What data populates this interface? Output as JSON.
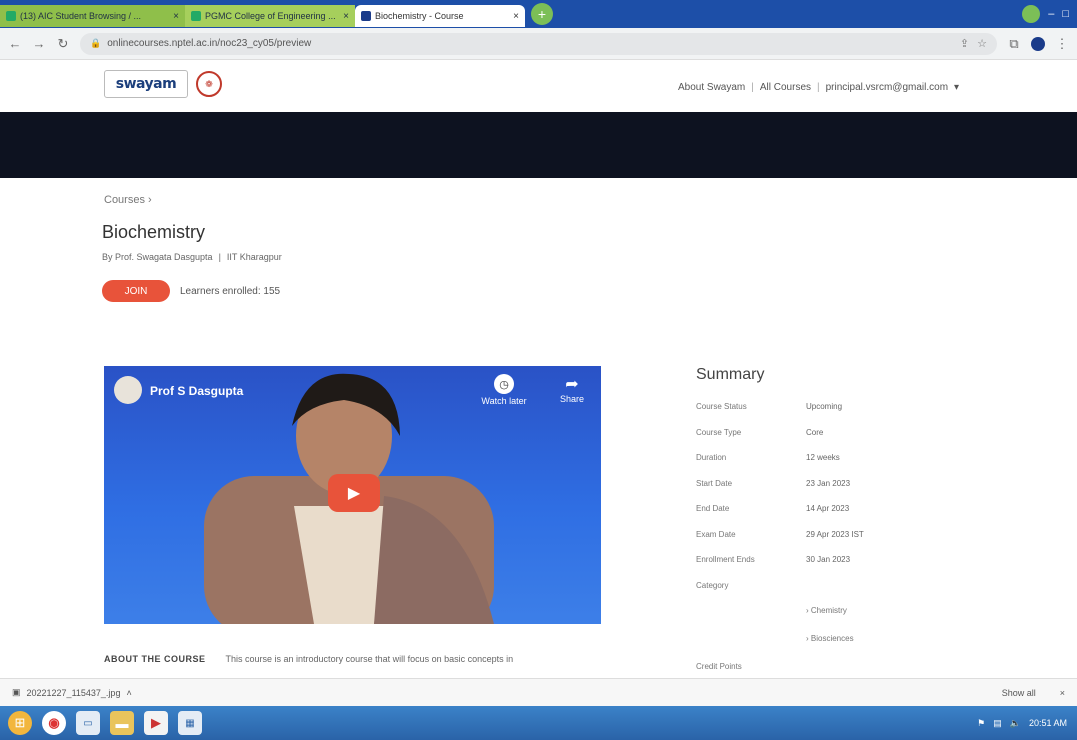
{
  "browser": {
    "tabs": [
      {
        "label": "(13) AIC Student Browsing / ..."
      },
      {
        "label": "PGMC College of Engineering ..."
      },
      {
        "label": "Biochemistry - Course"
      }
    ],
    "url": "onlinecourses.nptel.ac.in/noc23_cy05/preview"
  },
  "site": {
    "logo_text": "swayam",
    "nav": [
      "About Swayam",
      "All Courses",
      "principal.vsrcm@gmail.com"
    ]
  },
  "course": {
    "breadcrumb": "Courses  ›",
    "title": "Biochemistry",
    "instructor": "By Prof. Swagata Dasgupta",
    "institute": "IIT Kharagpur",
    "join_label": "JOIN",
    "learners": "Learners enrolled: 155"
  },
  "video": {
    "title": "Prof S Dasgupta",
    "watch_later": "Watch later",
    "share": "Share"
  },
  "about": {
    "heading": "ABOUT THE COURSE",
    "text": "This course is an introductory course that will focus on basic concepts in"
  },
  "summary": {
    "heading": "Summary",
    "rows": [
      {
        "k": "Course Status",
        "v": "Upcoming"
      },
      {
        "k": "Course Type",
        "v": "Core"
      },
      {
        "k": "Duration",
        "v": "12 weeks"
      },
      {
        "k": "Start Date",
        "v": "23 Jan 2023"
      },
      {
        "k": "End Date",
        "v": "14 Apr 2023"
      },
      {
        "k": "Exam Date",
        "v": "29 Apr 2023 IST"
      },
      {
        "k": "Enrollment Ends",
        "v": "30 Jan 2023"
      },
      {
        "k": "Category",
        "v": ""
      }
    ],
    "categories": [
      "Chemistry",
      "Biosciences"
    ],
    "credit_label": "Credit Points"
  },
  "downloads": {
    "file": "20221227_115437_.jpg",
    "show_all": "Show all"
  },
  "taskbar": {
    "tray_time": "20:51 AM"
  }
}
